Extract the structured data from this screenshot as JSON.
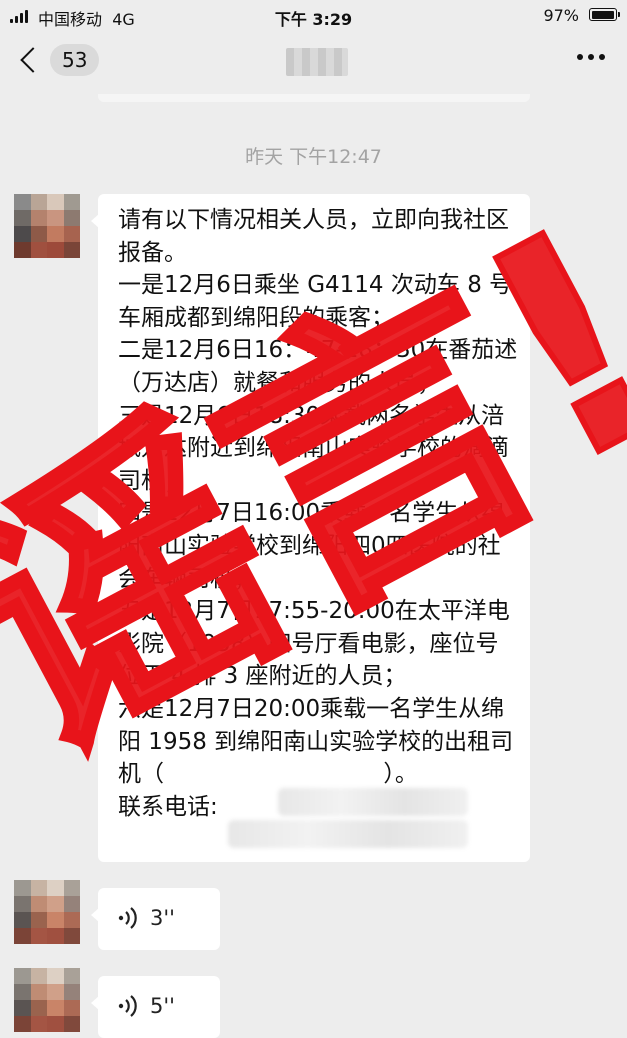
{
  "status_bar": {
    "carrier": "中国移动",
    "network": "4G",
    "time": "下午 3:29",
    "battery": "97%",
    "battery_level": 0.97
  },
  "nav": {
    "unread_count": "53",
    "more_icon": "ellipsis-icon",
    "back_icon": "chevron-left-icon"
  },
  "chat": {
    "timestamp": "昨天 下午12:47",
    "message_text": "请有以下情况相关人员，立即向我社区报备。\n一是12月6日乘坐 G4114 次动车 8 号车厢成都到绵阳段的乘客；\n二是12月6日16：47-18：30在番茄述（万达店）就餐和服务的人员；\n三是12月6日18:30乘载两名学生从涪城万达附近到绵阳南山实验学校的滴滴司机；\n四是12月7日16:00乘载一名学生从绵阳南山实验学校到绵阳四0四医院的社会车辆司机；\n五是12月7日17:55-20:00在太平洋电影院（1958）四号厅看电影，座位号位于 4 排 3 座附近的人员；\n六是12月7日20:00乘载一名学生从绵阳 1958 到绵阳南山实验学校的出租司机（                              ）。\n联系电话:",
    "voice_messages": [
      {
        "duration": "3''",
        "icon": "voice-wave-icon"
      },
      {
        "duration": "5''",
        "icon": "voice-wave-icon"
      }
    ]
  },
  "overlay": {
    "stamp_text": "谣言!",
    "stamp_color": "#e8141a"
  },
  "colors": {
    "background": "#ededed",
    "bubble": "#ffffff",
    "timestamp": "#a3a3a3"
  }
}
